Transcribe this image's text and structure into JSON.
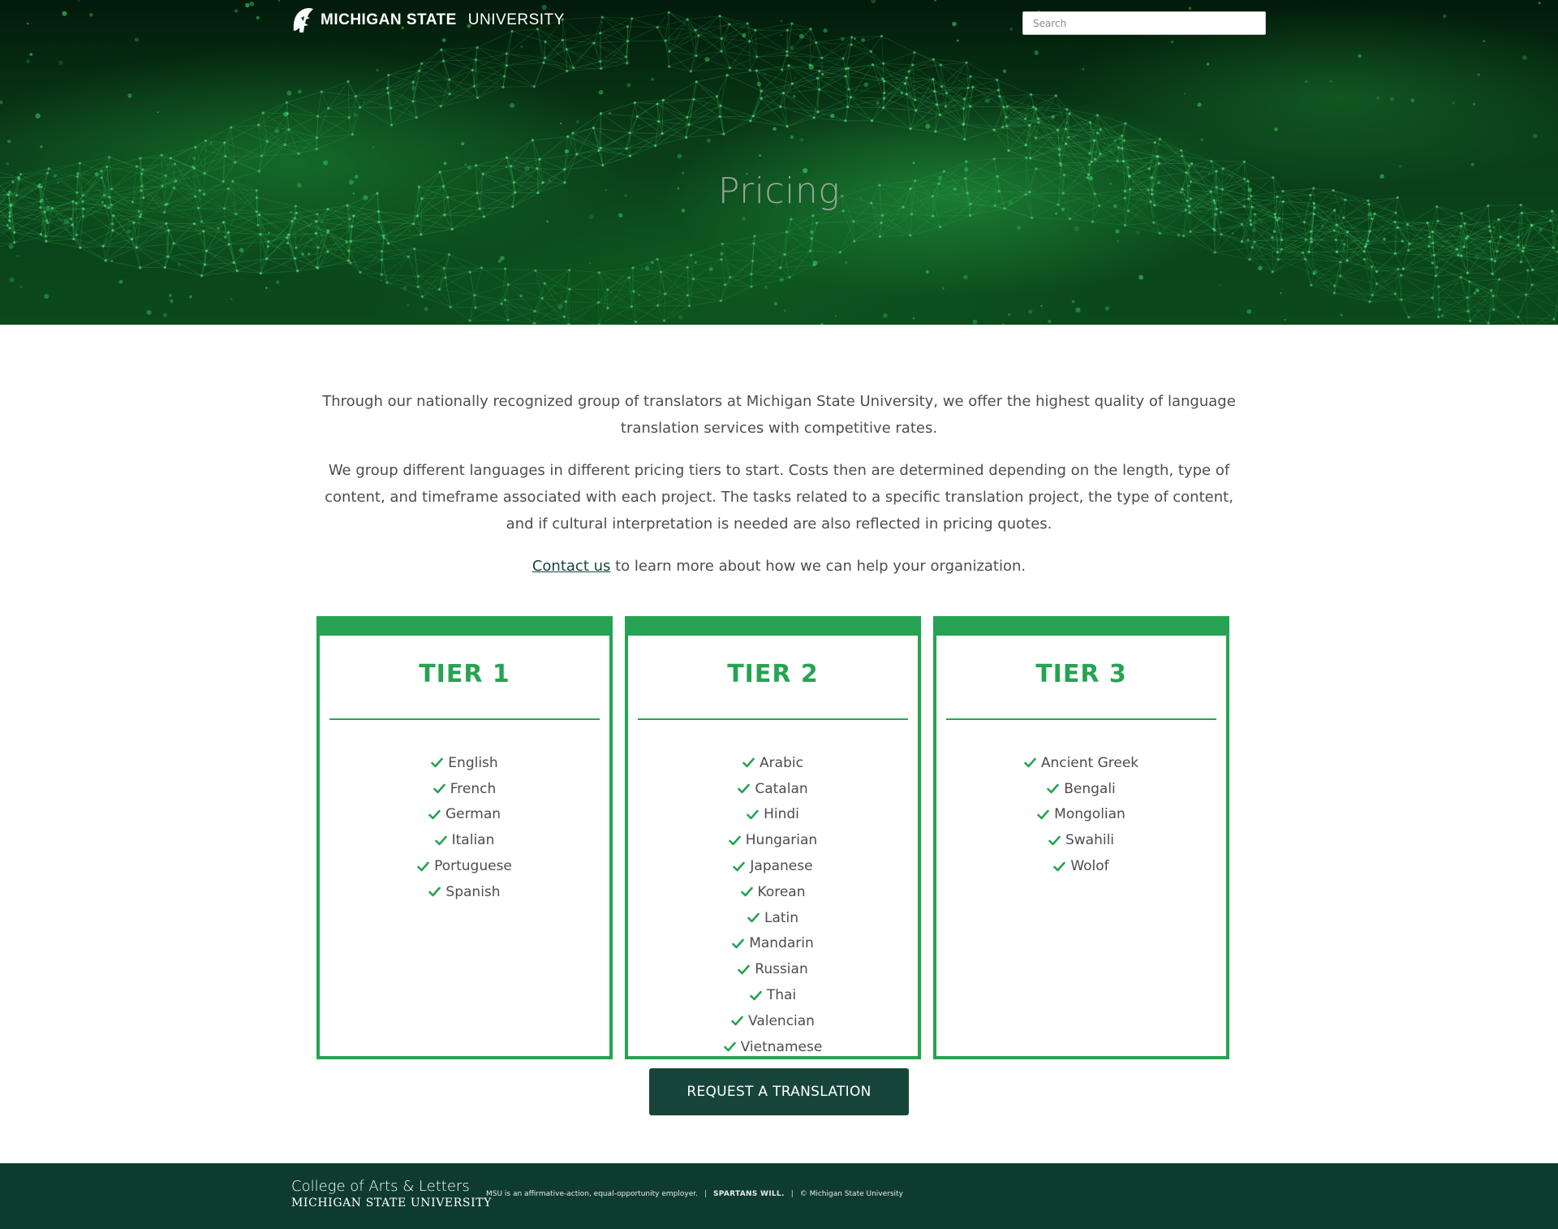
{
  "header": {
    "brand_bold": "MICHIGAN STATE",
    "brand_light": "UNIVERSITY",
    "search_placeholder": "Search"
  },
  "hero": {
    "title": "Pricing"
  },
  "intro": {
    "paragraph1": "Through our nationally recognized group of translators at Michigan State University, we offer the highest quality of language translation services with competitive rates.",
    "paragraph2": "We group different languages in different pricing tiers to start. Costs then are determined depending on the length, type of content, and timeframe associated with each project. The tasks related to a specific translation project, the type of content, and if cultural interpretation is needed are also reflected in pricing quotes.",
    "contact_link": "Contact us",
    "contact_rest": " to learn more about how we can help your organization."
  },
  "tiers": [
    {
      "title": "TIER 1",
      "languages": [
        "English",
        "French",
        "German",
        "Italian",
        "Portuguese",
        "Spanish"
      ]
    },
    {
      "title": "TIER 2",
      "languages": [
        "Arabic",
        "Catalan",
        "Hindi",
        "Hungarian",
        "Japanese",
        "Korean",
        "Latin",
        "Mandarin",
        "Russian",
        "Thai",
        "Valencian",
        "Vietnamese"
      ]
    },
    {
      "title": "TIER 3",
      "languages": [
        "Ancient Greek",
        "Bengali",
        "Mongolian",
        "Swahili",
        "Wolof"
      ]
    }
  ],
  "cta": {
    "label": "REQUEST A TRANSLATION"
  },
  "footer": {
    "college": "College of Arts & Letters",
    "university": "MICHIGAN STATE UNIVERSITY",
    "employer": "MSU is an affirmative-action, equal-opportunity employer.",
    "slogan": "SPARTANS WILL.",
    "copyright": "© Michigan State University"
  },
  "icons": {
    "logo": "spartan-helmet-icon",
    "list_bullet": "check-icon"
  },
  "colors": {
    "accent_green": "#26a352",
    "dark_green": "#18453b",
    "footer_green": "#0e3b30",
    "text_gray": "#4d4d4d"
  }
}
